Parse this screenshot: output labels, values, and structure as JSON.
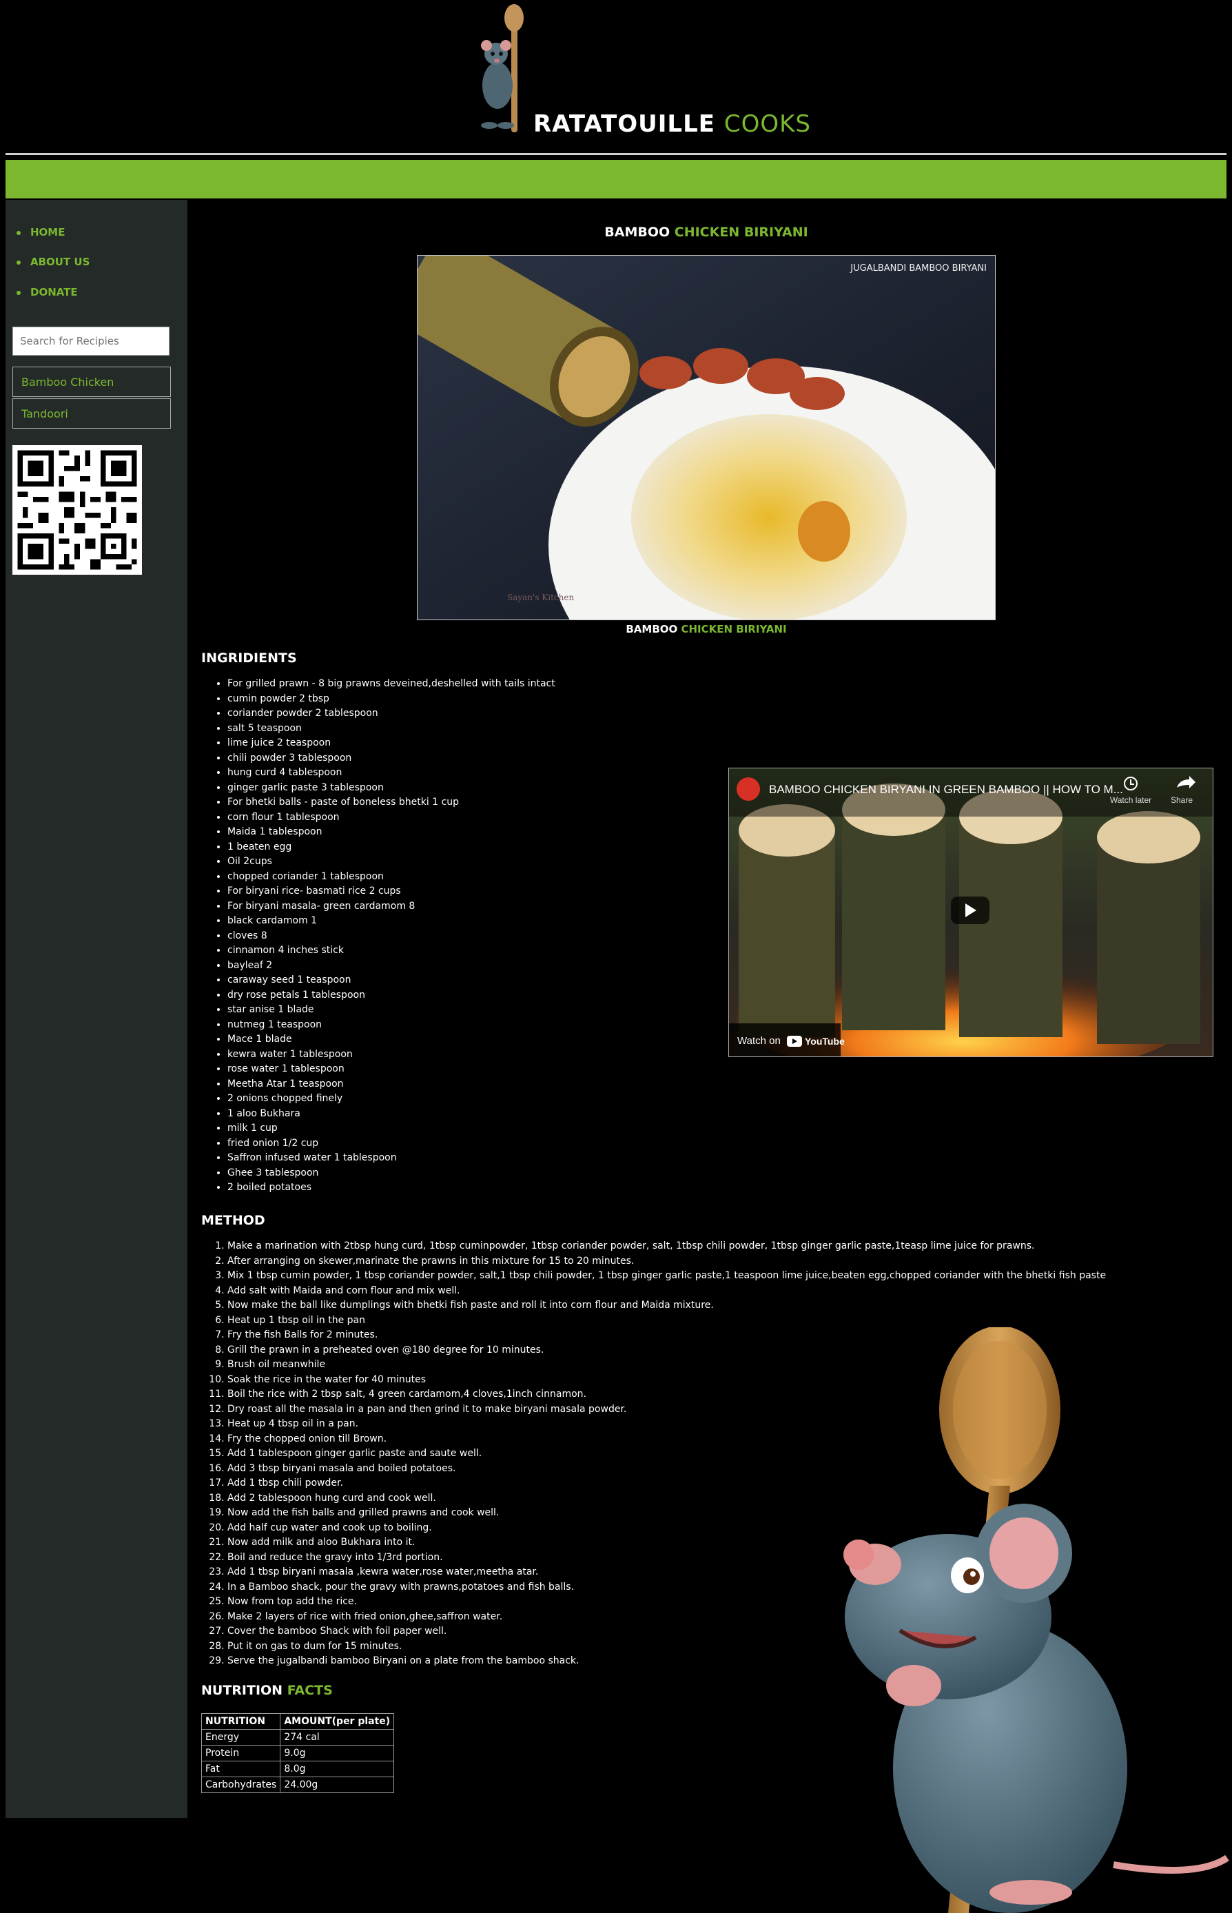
{
  "header": {
    "title_part1": "RATATOUILLE ",
    "title_part2": "COOKS"
  },
  "sidebar": {
    "nav": [
      {
        "label": "HOME"
      },
      {
        "label": "ABOUT US"
      },
      {
        "label": "DONATE"
      }
    ],
    "search_placeholder": "Search for Recipies",
    "recipe_links": [
      {
        "label": "Bamboo Chicken"
      },
      {
        "label": "Tandoori"
      }
    ]
  },
  "main": {
    "title_part1": "BAMBOO ",
    "title_part2": "CHICKEN BIRIYANI",
    "photo_overlay": "JUGALBANDI BAMBOO BIRYANI",
    "photo_watermark": "Sayan's Kitchen",
    "caption_part1": "BAMBOO ",
    "caption_part2": "CHICKEN BIRIYANI",
    "ingredients_heading": "INGRIDIENTS",
    "ingredients": [
      "For grilled prawn - 8 big prawns deveined,deshelled with tails intact",
      "cumin powder 2 tbsp",
      "coriander powder 2 tablespoon",
      "salt 5 teaspoon",
      "lime juice 2 teaspoon",
      "chili powder 3 tablespoon",
      "hung curd 4 tablespoon",
      "ginger garlic paste 3 tablespoon",
      "For bhetki balls - paste of boneless bhetki 1 cup",
      "corn flour 1 tablespoon",
      "Maida 1 tablespoon",
      "1 beaten egg",
      "Oil 2cups",
      "chopped coriander 1 tablespoon",
      "For biryani rice- basmati rice 2 cups",
      "For biryani masala- green cardamom 8",
      "black cardamom 1",
      "cloves 8",
      "cinnamon 4 inches stick",
      "bayleaf 2",
      "caraway seed 1 teaspoon",
      "dry rose petals 1 tablespoon",
      "star anise 1 blade",
      "nutmeg 1 teaspoon",
      "Mace 1 blade",
      "kewra water 1 tablespoon",
      "rose water 1 tablespoon",
      "Meetha Atar 1 teaspoon",
      "2 onions chopped finely",
      "1 aloo Bukhara",
      "milk 1 cup",
      "fried onion 1/2 cup",
      "Saffron infused water 1 tablespoon",
      "Ghee 3 tablespoon",
      "2 boiled potatoes"
    ],
    "video": {
      "title": "BAMBOO CHICKEN BIRYANI IN GREEN BAMBOO || HOW TO M...",
      "watch_later": "Watch later",
      "share": "Share",
      "watch_on": "Watch on",
      "youtube": "YouTube"
    },
    "method_heading": "METHOD",
    "method": [
      "Make a marination with 2tbsp hung curd, 1tbsp cuminpowder, 1tbsp coriander powder, salt, 1tbsp chili powder, 1tbsp ginger garlic paste,1teasp lime juice for prawns.",
      "After arranging on skewer,marinate the prawns in this mixture for 15 to 20 minutes.",
      "Mix 1 tbsp cumin powder, 1 tbsp coriander powder, salt,1 tbsp chili powder, 1 tbsp ginger garlic paste,1 teaspoon lime juice,beaten egg,chopped coriander with the bhetki fish paste",
      "Add salt with Maida and corn flour and mix well.",
      "Now make the ball like dumplings with bhetki fish paste and roll it into corn flour and Maida mixture.",
      "Heat up 1 tbsp oil in the pan",
      "Fry the fish Balls for 2 minutes.",
      "Grill the prawn in a preheated oven @180 degree for 10 minutes.",
      "Brush oil meanwhile",
      "Soak the rice in the water for 40 minutes",
      "Boil the rice with 2 tbsp salt, 4 green cardamom,4 cloves,1inch cinnamon.",
      "Dry roast all the masala in a pan and then grind it to make biryani masala powder.",
      "Heat up 4 tbsp oil in a pan.",
      "Fry the chopped onion till Brown.",
      "Add 1 tablespoon ginger garlic paste and saute well.",
      "Add 3 tbsp biryani masala and boiled potatoes.",
      "Add 1 tbsp chili powder.",
      "Add 2 tablespoon hung curd and cook well.",
      "Now add the fish balls and grilled prawns and cook well.",
      "Add half cup water and cook up to boiling.",
      "Now add milk and aloo Bukhara into it.",
      "Boil and reduce the gravy into 1/3rd portion.",
      "Add 1 tbsp biryani masala ,kewra water,rose water,meetha atar.",
      "In a Bamboo shack, pour the gravy with prawns,potatoes and fish balls.",
      "Now from top add the rice.",
      "Make 2 layers of rice with fried onion,ghee,saffron water.",
      "Cover the bamboo Shack with foil paper well.",
      "Put it on gas to dum for 15 minutes.",
      "Serve the jugalbandi bamboo Biryani on a plate from the bamboo shack."
    ],
    "nutrition_heading_part1": "NUTRITION ",
    "nutrition_heading_part2": "FACTS",
    "nutrition_table": {
      "headers": [
        "NUTRITION",
        "AMOUNT(per plate)"
      ],
      "rows": [
        [
          "Energy",
          "274 cal"
        ],
        [
          "Protein",
          "9.0g"
        ],
        [
          "Fat",
          "8.0g"
        ],
        [
          "Carbohydrates",
          "24.00g"
        ]
      ]
    }
  }
}
